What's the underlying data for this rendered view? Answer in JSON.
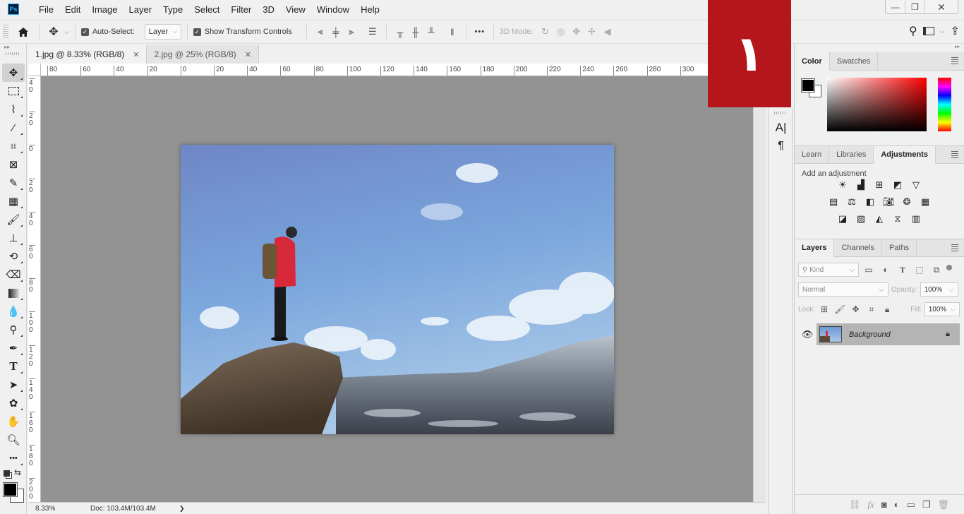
{
  "app": {
    "logo": "Ps"
  },
  "menu": [
    "File",
    "Edit",
    "Image",
    "Layer",
    "Type",
    "Select",
    "Filter",
    "3D",
    "View",
    "Window",
    "Help"
  ],
  "window_controls": {
    "minimize": "—",
    "restore": "❐",
    "close": "✕"
  },
  "options_bar": {
    "auto_select_label": "Auto-Select:",
    "auto_select_checked": true,
    "auto_select_target": "Layer",
    "show_transform_label": "Show Transform Controls",
    "show_transform_checked": true,
    "more_label": "•••",
    "mode_3d_label": "3D Mode:"
  },
  "doc_tabs": [
    {
      "label": "1.jpg @ 8.33% (RGB/8)",
      "active": true
    },
    {
      "label": "2.jpg @ 25% (RGB/8)",
      "active": false
    }
  ],
  "hruler_ticks": [
    "80",
    "60",
    "40",
    "20",
    "0",
    "20",
    "40",
    "60",
    "80",
    "100",
    "120",
    "140",
    "160",
    "180",
    "200",
    "220",
    "240",
    "260",
    "280",
    "300"
  ],
  "vruler_ticks": [
    "40",
    "20",
    "0",
    "20",
    "40",
    "60",
    "80",
    "100",
    "120",
    "140",
    "160",
    "180",
    "200"
  ],
  "badge": {
    "text": "١",
    "color": "#b4161b"
  },
  "status": {
    "zoom": "8.33%",
    "doc": "Doc: 103.4M/103.4M",
    "arrow": "❯"
  },
  "color_panel": {
    "tabs": [
      "Color",
      "Swatches"
    ],
    "active_tab": "Color",
    "foreground": "#000000",
    "background": "#ffffff",
    "hue": "#ff0000"
  },
  "adjust_panel": {
    "tabs": [
      "Learn",
      "Libraries",
      "Adjustments"
    ],
    "active_tab": "Adjustments",
    "heading": "Add an adjustment"
  },
  "layers_panel": {
    "tabs": [
      "Layers",
      "Channels",
      "Paths"
    ],
    "active_tab": "Layers",
    "filter_placeholder": "Kind",
    "blend_mode": "Normal",
    "opacity_label": "Opacity:",
    "opacity": "100%",
    "lock_label": "Lock:",
    "fill_label": "Fill:",
    "fill": "100%",
    "layers": [
      {
        "name": "Background",
        "visible": true,
        "locked": true
      }
    ]
  }
}
